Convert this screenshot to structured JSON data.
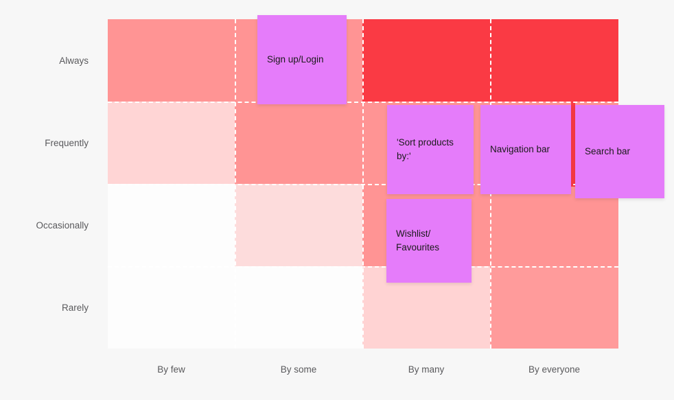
{
  "chart_data": {
    "type": "heatmap",
    "title": "",
    "xlabel": "",
    "ylabel": "",
    "x_categories": [
      "By few",
      "By some",
      "By many",
      "By everyone"
    ],
    "y_categories": [
      "Always",
      "Frequently",
      "Occasionally",
      "Rarely"
    ],
    "legend": "none",
    "grid": "dashed white separators between cells",
    "colors": {
      "background": "#f7f7f7",
      "heat_max": "#fa3a44",
      "heat_mid": "#ff9494",
      "heat_low": "#ffd2d2",
      "heat_none": "#fdfdfd",
      "note_fill": "#e57cfa",
      "label_text": "#59595c",
      "note_text": "#1a1a1a",
      "separator": "#ffffff"
    },
    "values": [
      [
        0.5,
        0.5,
        1.0,
        1.0
      ],
      [
        0.18,
        0.5,
        0.5,
        0.5
      ],
      [
        0.02,
        0.22,
        0.5,
        0.5
      ],
      [
        0.02,
        0.02,
        0.2,
        0.45
      ]
    ],
    "cell_fills": [
      [
        "#ff9494",
        "#ff9494",
        "#fa3a44",
        "#fa3a44"
      ],
      [
        "#ffd5d5",
        "#ff9494",
        "#ff9494",
        "#ff9494"
      ],
      [
        "#fdfdfd",
        "#fddcdc",
        "#ff9494",
        "#ff9494"
      ],
      [
        "#fdfdfd",
        "#fdfdfd",
        "#ffd3d3",
        "#ff9b9b"
      ]
    ],
    "notes": [
      {
        "label": "Sign up/Login",
        "row": "Always",
        "column": "By some"
      },
      {
        "label": "'Sort products\nby:'",
        "row": "Frequently",
        "column": "By many"
      },
      {
        "label": "Navigation bar",
        "row": "Frequently",
        "column": "By everyone"
      },
      {
        "label": "Search bar",
        "row": "Frequently",
        "column": "By everyone"
      },
      {
        "label": "Wishlist/\nFavourites",
        "row": "Occasionally",
        "column": "By many"
      }
    ],
    "highlight_overlays": [
      {
        "name": "always-by-many-to-everyone",
        "color": "#fa3a44"
      },
      {
        "name": "frequently-search-bar-accent",
        "color": "#fa3a44"
      }
    ]
  },
  "axes": {
    "y_labels": [
      "Always",
      "Frequently",
      "Occasionally",
      "Rarely"
    ],
    "x_labels": [
      "By few",
      "By some",
      "By many",
      "By everyone"
    ]
  },
  "notes": {
    "sign_up_login": "Sign up/Login",
    "sort_products_by": "'Sort products\nby:'",
    "navigation_bar": "Navigation bar",
    "search_bar": "Search bar",
    "wishlist_favourites": "Wishlist/\nFavourites"
  }
}
